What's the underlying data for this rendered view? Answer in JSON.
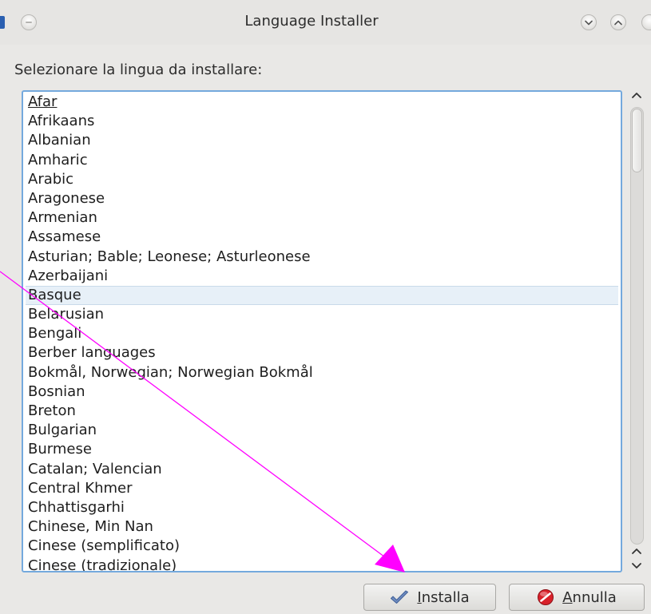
{
  "window": {
    "title": "Language Installer"
  },
  "prompt": "Selezionare la lingua da installare:",
  "languages": {
    "current_index": 0,
    "selected_index": 10,
    "items": [
      "Afar",
      "Afrikaans",
      "Albanian",
      "Amharic",
      "Arabic",
      "Aragonese",
      "Armenian",
      "Assamese",
      "Asturian; Bable; Leonese; Asturleonese",
      "Azerbaijani",
      "Basque",
      "Belarusian",
      "Bengali",
      "Berber languages",
      "Bokmål, Norwegian; Norwegian Bokmål",
      "Bosnian",
      "Breton",
      "Bulgarian",
      "Burmese",
      "Catalan; Valencian",
      "Central Khmer",
      "Chhattisgarhi",
      "Chinese, Min Nan",
      "Cinese (semplificato)",
      "Cinese (tradizionale)"
    ]
  },
  "buttons": {
    "install": {
      "mnemonic": "I",
      "rest": "nstalla",
      "icon": "checkmark-icon"
    },
    "cancel": {
      "mnemonic": "A",
      "rest": "nnulla",
      "icon": "cancel-icon"
    }
  },
  "colors": {
    "list_focus_border": "#74a9dd",
    "selection_background": "#e7f0f8",
    "annotation_arrow": "#ff00ff"
  }
}
